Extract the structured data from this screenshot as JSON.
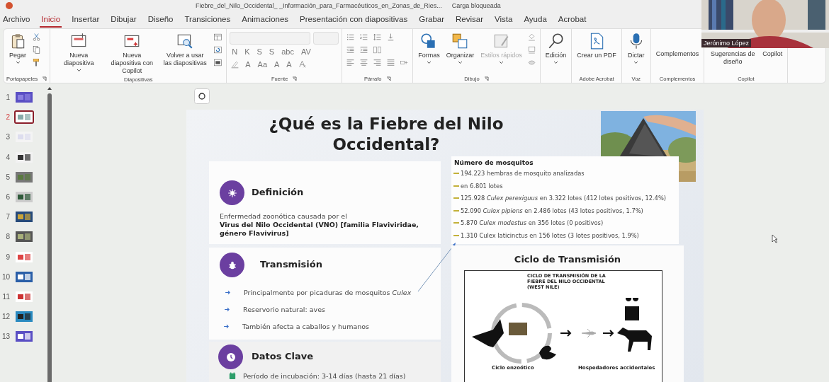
{
  "title_bar": {
    "document": "Fiebre_del_Nilo_Occidental_ _Información_para_Farmacéuticos_en_Zonas_de_Ries...",
    "status": "Carga bloqueada"
  },
  "menu": [
    {
      "label": "Archivo",
      "selected": false
    },
    {
      "label": "Inicio",
      "selected": true
    },
    {
      "label": "Insertar",
      "selected": false
    },
    {
      "label": "Dibujar",
      "selected": false
    },
    {
      "label": "Diseño",
      "selected": false
    },
    {
      "label": "Transiciones",
      "selected": false
    },
    {
      "label": "Animaciones",
      "selected": false
    },
    {
      "label": "Presentación con diapositivas",
      "selected": false
    },
    {
      "label": "Grabar",
      "selected": false
    },
    {
      "label": "Revisar",
      "selected": false
    },
    {
      "label": "Vista",
      "selected": false
    },
    {
      "label": "Ayuda",
      "selected": false
    },
    {
      "label": "Acrobat",
      "selected": false
    }
  ],
  "ribbon": [
    {
      "name": "Portapapeles",
      "launcher": true,
      "items": [
        {
          "kind": "large",
          "label": "Pegar",
          "dropdown": true,
          "disabled": false
        },
        {
          "kind": "icon"
        },
        {
          "kind": "icon"
        },
        {
          "kind": "icon"
        }
      ]
    },
    {
      "name": "Diapositivas",
      "launcher": false,
      "items": [
        {
          "kind": "large",
          "label": "Nueva diapositiva",
          "dropdown": true,
          "disabled": false
        },
        {
          "kind": "large",
          "label": "Nueva diapositiva con Copilot",
          "dropdown": false,
          "disabled": false
        },
        {
          "kind": "large",
          "label": "Volver a usar las diapositivas",
          "dropdown": false,
          "disabled": false
        },
        {
          "kind": "icon"
        },
        {
          "kind": "icon"
        },
        {
          "kind": "icon"
        }
      ]
    },
    {
      "name": "Fuente",
      "launcher": true,
      "rows": [
        [
          {
            "kind": "field"
          },
          {
            "kind": "field"
          }
        ],
        [
          {
            "kind": "glyph",
            "label": "N"
          },
          {
            "kind": "glyph",
            "label": "K"
          },
          {
            "kind": "glyph",
            "label": "S"
          },
          {
            "kind": "glyph",
            "label": "S"
          },
          {
            "kind": "glyph",
            "label": "abc"
          },
          {
            "kind": "glyph",
            "label": "AV"
          }
        ],
        [
          {
            "kind": "icon"
          },
          {
            "kind": "glyph",
            "label": "A"
          },
          {
            "kind": "glyph",
            "label": "Aa"
          },
          {
            "kind": "glyph",
            "label": "A"
          },
          {
            "kind": "glyph",
            "label": "A"
          },
          {
            "kind": "icon"
          }
        ]
      ]
    },
    {
      "name": "Párrafo",
      "launcher": true,
      "rows": [
        [
          {
            "kind": "icon"
          },
          {
            "kind": "icon"
          },
          {
            "kind": "icon"
          },
          {
            "kind": "icon"
          }
        ],
        [
          {
            "kind": "icon"
          },
          {
            "kind": "icon"
          },
          {
            "kind": "icon"
          }
        ],
        [
          {
            "kind": "icon"
          },
          {
            "kind": "icon"
          },
          {
            "kind": "icon"
          },
          {
            "kind": "icon"
          },
          {
            "kind": "icon"
          }
        ]
      ]
    },
    {
      "name": "Dibujo",
      "launcher": true,
      "items": [
        {
          "kind": "large",
          "label": "Formas",
          "dropdown": true,
          "disabled": false
        },
        {
          "kind": "large",
          "label": "Organizar",
          "dropdown": true,
          "disabled": false
        },
        {
          "kind": "large",
          "label": "Estilos rápidos",
          "dropdown": true,
          "disabled": true
        },
        {
          "kind": "icon"
        },
        {
          "kind": "icon"
        },
        {
          "kind": "icon"
        }
      ]
    },
    {
      "launcher": false,
      "items": [
        {
          "kind": "large",
          "label": "Edición",
          "dropdown": true,
          "disabled": false
        }
      ]
    },
    {
      "name": "Adobe Acrobat",
      "launcher": false,
      "items": [
        {
          "kind": "large",
          "label": "Crear un PDF",
          "dropdown": false,
          "disabled": false
        }
      ]
    },
    {
      "name": "Voz",
      "launcher": false,
      "items": [
        {
          "kind": "large",
          "label": "Dictar",
          "dropdown": true,
          "disabled": false
        }
      ]
    },
    {
      "name": "Complementos",
      "launcher": false,
      "items": [
        {
          "kind": "large",
          "label": "Complementos",
          "dropdown": false,
          "disabled": false
        }
      ]
    },
    {
      "name": "Copilot",
      "launcher": false,
      "items": [
        {
          "kind": "large",
          "label": "Sugerencias de diseño",
          "dropdown": false,
          "disabled": false
        },
        {
          "kind": "large",
          "label": "Copilot",
          "dropdown": false,
          "disabled": false
        }
      ]
    }
  ],
  "slides": [
    {
      "number": "1",
      "selected": false
    },
    {
      "number": "2",
      "selected": true
    },
    {
      "number": "3",
      "selected": false
    },
    {
      "number": "4",
      "selected": false
    },
    {
      "number": "5",
      "selected": false
    },
    {
      "number": "6",
      "selected": false
    },
    {
      "number": "7",
      "selected": false
    },
    {
      "number": "8",
      "selected": false
    },
    {
      "number": "9",
      "selected": false
    },
    {
      "number": "10",
      "selected": false
    },
    {
      "number": "11",
      "selected": false
    },
    {
      "number": "12",
      "selected": false
    },
    {
      "number": "13",
      "selected": false
    }
  ],
  "slide": {
    "title": "¿Qué es la Fiebre del Nilo Occidental?",
    "cards": [
      {
        "kind": "definition",
        "heading": "Definición",
        "text": "Enfermedad zoonótica causada por el",
        "bold_text": "Virus del Nilo Occidental (VNO) [familia Flaviviridae, género Flavivirus]"
      },
      {
        "kind": "bullets",
        "heading": "Transmisión",
        "bullets": [
          "Principalmente por picaduras de mosquitos *Culex*",
          "Reservorio natural: aves",
          "También afecta a caballos y humanos"
        ]
      },
      {
        "kind": "facts",
        "heading": "Datos Clave",
        "bullets": [
          "Período de incubación: 3-14 días (hasta 21 días)"
        ]
      }
    ],
    "mosquitoes": {
      "heading": "Número de mosquitos",
      "items": [
        "194.223 hembras de mosquito analizadas",
        "en 6.801 lotes",
        "125.928 *Culex perexiguus* en 3.322 lotes (412 lotes positivos, 12.4%)",
        "52.090 *Culex pipiens* en 2.486 lotes (43 lotes positivos, 1.7%)",
        "5.870 *Culex modestus* en 356 lotes (0 positivos)",
        "1.310 Culex laticinctus en 156 lotes (3 lotes positivos, 1.9%)"
      ]
    },
    "cycle": {
      "heading": "Ciclo de Transmisión",
      "diagram_title": "CICLO DE TRANSMISIÓN DE LA FIEBRE DEL NILO OCCIDENTAL (WEST NILE)",
      "left_label": "Ciclo enzoótico",
      "right_label": "Hospedadores accidentales"
    }
  },
  "webcam": {
    "name": "Jerónimo López"
  }
}
